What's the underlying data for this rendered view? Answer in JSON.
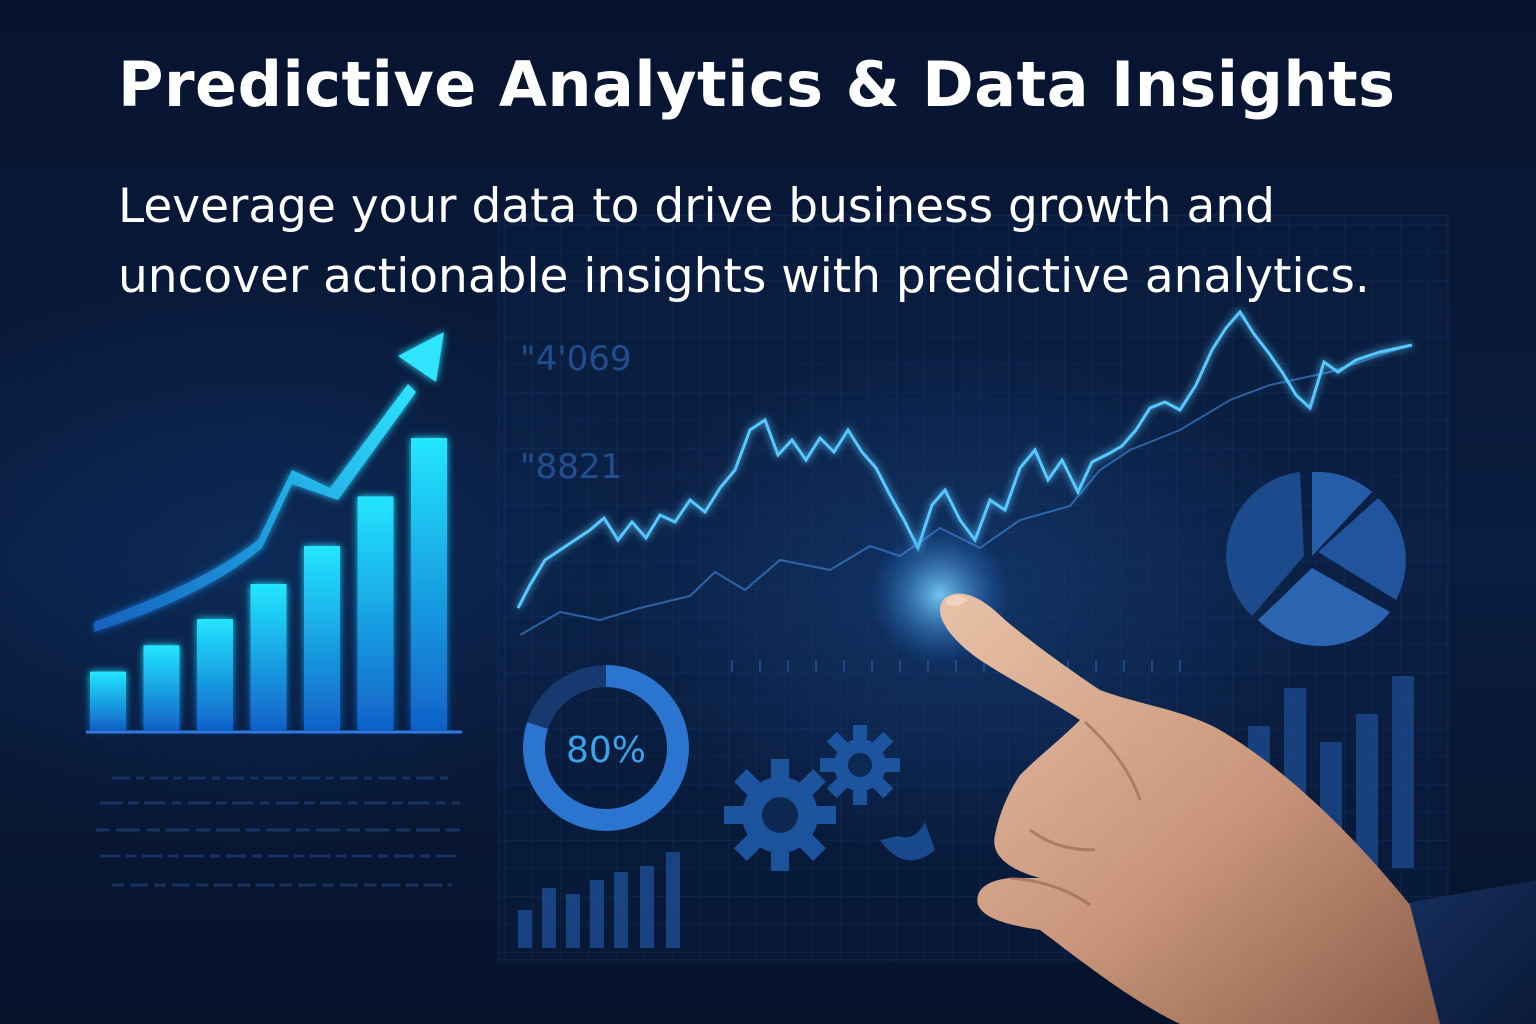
{
  "header": {
    "title": "Predictive Analytics & Data Insights",
    "subtitle_line1": "Leverage your data to drive business growth and",
    "subtitle_line2": "uncover actionable insights with predictive analytics."
  },
  "dashboard": {
    "readout_top": "\"4'069",
    "readout_mid": "\"8821",
    "gauge_label": "80%",
    "gauge_value": 0.8
  },
  "growth_chart": {
    "bar_levels": [
      0.2,
      0.29,
      0.38,
      0.5,
      0.63,
      0.8,
      1.0
    ]
  },
  "colors": {
    "accent_cyan": "#22d3ff",
    "panel_blue": "#1e5aa8",
    "background": "#071430"
  }
}
